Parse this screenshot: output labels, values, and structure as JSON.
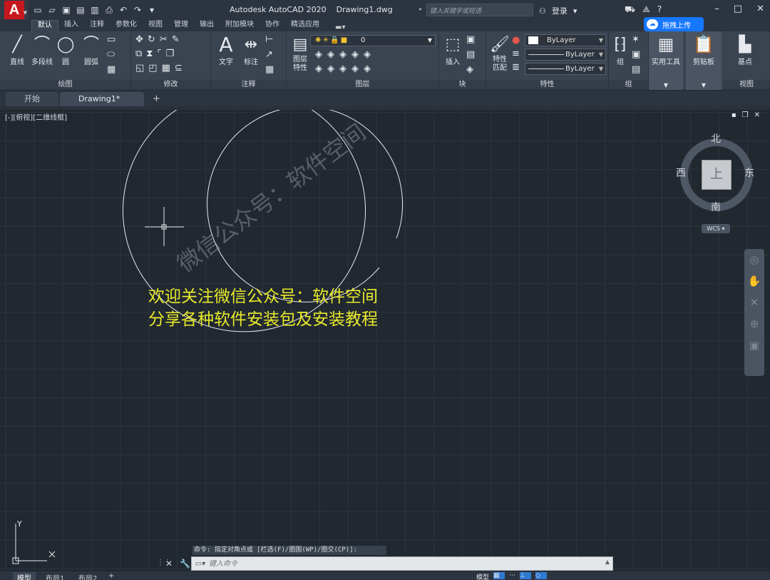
{
  "app": {
    "logo_letter": "A",
    "title": "Autodesk AutoCAD 2020",
    "document": "Drawing1.dwg",
    "search_placeholder": "键入关键字或短语",
    "login_label": "登录",
    "help_icon": "question-icon"
  },
  "ribbon_tabs": [
    "默认",
    "插入",
    "注释",
    "参数化",
    "视图",
    "管理",
    "输出",
    "附加模块",
    "协作",
    "精选应用"
  ],
  "active_tab": "默认",
  "cloud_button": "拖拽上传",
  "panels": {
    "draw": {
      "title": "绘图",
      "line": "直线",
      "polyline": "多段线",
      "circle": "圆",
      "arc": "圆弧"
    },
    "modify": {
      "title": "修改"
    },
    "annotation": {
      "title": "注释",
      "text": "文字",
      "dimension": "标注"
    },
    "layers": {
      "title": "图层",
      "layer_properties": "图层\n特性",
      "current_layer": "0"
    },
    "block": {
      "title": "块",
      "insert": "插入"
    },
    "properties": {
      "title": "特性",
      "match": "特性\n匹配",
      "color": "ByLayer",
      "linetype": "ByLayer",
      "lineweight": "ByLayer"
    },
    "groups": {
      "title": "组",
      "group": "组"
    },
    "utilities": {
      "title": "实用工具"
    },
    "clipboard": {
      "title": "剪贴板"
    },
    "view": {
      "title": "视图",
      "base": "基点"
    }
  },
  "file_tabs": [
    "开始",
    "Drawing1*"
  ],
  "viewport": {
    "label": "[-][俯视][二维线框]"
  },
  "viewcube": {
    "north": "北",
    "south": "南",
    "west": "西",
    "east": "东",
    "face": "上",
    "wcs": "WCS"
  },
  "canvas_text": {
    "line1": "欢迎关注微信公众号：软件空间",
    "line2": "分享各种软件安装包及安装教程",
    "watermark": "微信公众号：软件空间"
  },
  "ucs": {
    "y": "Y",
    "x": "X"
  },
  "command": {
    "history": "命令: 指定对角点或 [栏选(F)/圈围(WP)/圈交(CP)]:",
    "placeholder": "键入命令"
  },
  "status_tabs": [
    "模型",
    "布局1",
    "布局2"
  ],
  "status_model": "模型",
  "colors": {
    "canvas_bg": "#212830",
    "ribbon_bg": "#3a4451",
    "text_highlight": "#e8ea2b",
    "cloud_blue": "#1677ff",
    "autocad_red": "#c8161e"
  }
}
